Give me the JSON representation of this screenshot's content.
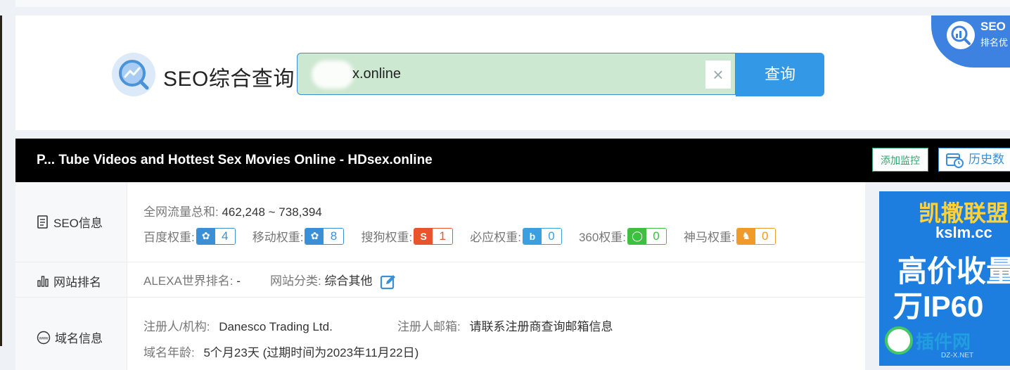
{
  "search": {
    "title": "SEO综合查询",
    "query_value": "x.online",
    "clear_symbol": "×",
    "button_label": "查询"
  },
  "promo": {
    "line1": "SEO",
    "line2": "排名优"
  },
  "site": {
    "title": "P... Tube Videos and Hottest Sex Movies Online - HDsex.online",
    "monitor_label": "添加监控",
    "history_label": "历史数"
  },
  "seo_info": {
    "header": "SEO信息",
    "traffic_label": "全网流量总和:",
    "traffic_value": "462,248 ~ 738,394",
    "weights": [
      {
        "label": "百度权重:",
        "value": "4",
        "color": "#3b8fd6",
        "icon": "paw-icon"
      },
      {
        "label": "移动权重:",
        "value": "8",
        "color": "#3b8fd6",
        "icon": "paw-icon"
      },
      {
        "label": "搜狗权重:",
        "value": "1",
        "color": "#e8552c",
        "icon": "sogou-icon"
      },
      {
        "label": "必应权重:",
        "value": "0",
        "color": "#3b9fe0",
        "icon": "bing-icon"
      },
      {
        "label": "360权重:",
        "value": "0",
        "color": "#3fbf3f",
        "icon": "360-icon"
      },
      {
        "label": "神马权重:",
        "value": "0",
        "color": "#f09a2a",
        "icon": "shenma-icon"
      }
    ]
  },
  "rank": {
    "header": "网站排名",
    "alexa_label": "ALEXA世界排名:",
    "alexa_value": "-",
    "category_label": "网站分类:",
    "category_value": "综合其他"
  },
  "domain": {
    "header": "域名信息",
    "registrant_label": "注册人/机构:",
    "registrant_value": "Danesco Trading Ltd.",
    "email_label": "注册人邮箱:",
    "email_value": "请联系注册商查询邮箱信息",
    "age_label": "域名年龄:",
    "age_value": "5个月23天",
    "expiry": "(过期时间为2023年11月22日)"
  },
  "ad": {
    "line1": "凯撒联盟",
    "line2": "kslm.cc",
    "line3": "高价收量",
    "line4": "万IP60",
    "watermark": "插件网",
    "watermark_sub": "DZ-X.NET"
  }
}
